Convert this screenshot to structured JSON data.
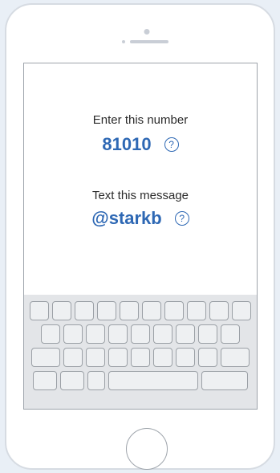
{
  "number_section": {
    "label": "Enter this number",
    "value": "81010",
    "help_glyph": "?"
  },
  "message_section": {
    "label": "Text this message",
    "value": "@starkb",
    "help_glyph": "?"
  },
  "colors": {
    "accent": "#2e68b4",
    "background": "#e9eff6",
    "keyboard": "#e3e5e8"
  }
}
